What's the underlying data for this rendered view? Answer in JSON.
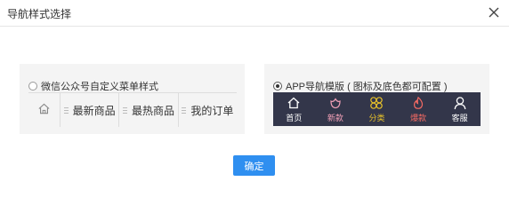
{
  "dialog": {
    "title": "导航样式选择",
    "close_icon": "close-icon"
  },
  "options": [
    {
      "id": "wechat",
      "label": "微信公众号自定义菜单样式",
      "selected": false,
      "menu": {
        "home_icon": "home-icon",
        "items": [
          "最新商品",
          "最热商品",
          "我的订单"
        ]
      }
    },
    {
      "id": "app",
      "label": "APP导航模版 ( 图标及底色都可配置 )",
      "selected": true,
      "nav": {
        "background": "#33364a",
        "items": [
          {
            "label": "首页",
            "icon": "home-icon",
            "color": "#ffffff"
          },
          {
            "label": "新款",
            "icon": "flower-icon",
            "color": "#f3a1b8"
          },
          {
            "label": "分类",
            "icon": "clover-grid-icon",
            "color": "#e8c22a"
          },
          {
            "label": "爆款",
            "icon": "fire-icon",
            "color": "#f36a63"
          },
          {
            "label": "客服",
            "icon": "user-icon",
            "color": "#ffffff"
          }
        ]
      }
    }
  ],
  "confirm_label": "确定",
  "colors": {
    "primary": "#2f8ff0",
    "panel_bg": "#f4f4f4"
  }
}
